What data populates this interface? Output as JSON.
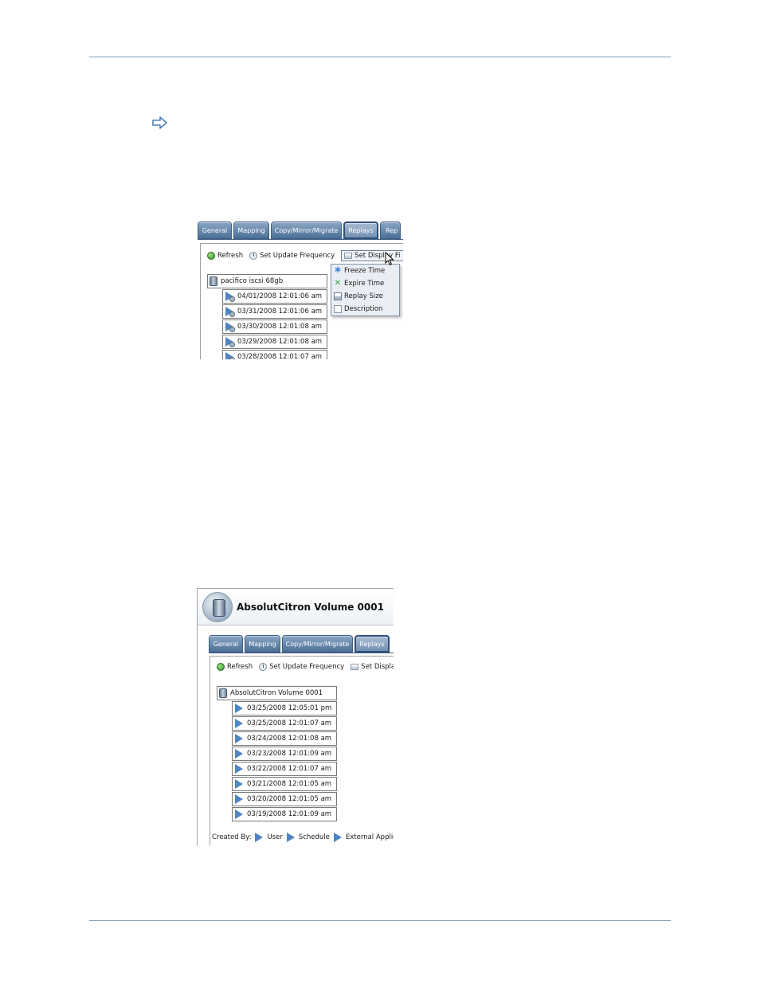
{
  "screenshot1": {
    "tabs": [
      "General",
      "Mapping",
      "Copy/Mirror/Migrate",
      "Replays",
      "Rep"
    ],
    "active_tab": "Replays",
    "toolbar": {
      "refresh": "Refresh",
      "update_frequency": "Set Update Frequency",
      "display_fields": "Set Display Fi"
    },
    "tree": {
      "root": "pacifico iscsi 68gb",
      "replays": [
        "04/01/2008 12:01:06 am",
        "03/31/2008 12:01:06 am",
        "03/30/2008 12:01:08 am",
        "03/29/2008 12:01:08 am",
        "03/28/2008 12:01:07 am"
      ]
    },
    "menu": {
      "items": [
        "Freeze Time",
        "Expire Time",
        "Replay Size",
        "Description"
      ]
    }
  },
  "screenshot2": {
    "title": "AbsolutCitron Volume 0001",
    "tabs": [
      "General",
      "Mapping",
      "Copy/Mirror/Migrate",
      "Replays"
    ],
    "active_tab": "Replays",
    "toolbar": {
      "refresh": "Refresh",
      "update_frequency": "Set Update Frequency",
      "display_fields": "Set Display F"
    },
    "tree": {
      "root": "AbsolutCitron Volume 0001",
      "replays": [
        "03/25/2008 12:05:01 pm",
        "03/25/2008 12:01:07 am",
        "03/24/2008 12:01:08 am",
        "03/23/2008 12:01:09 am",
        "03/22/2008 12:01:07 am",
        "03/21/2008 12:01:05 am",
        "03/20/2008 12:01:05 am",
        "03/19/2008 12:01:09 am"
      ]
    },
    "legend": {
      "label": "Created By:",
      "items": [
        "User",
        "Schedule",
        "External Application"
      ]
    }
  },
  "colors": {
    "rule": "#7f9fb6",
    "tab": "#4b6f97",
    "replay_icon": "#4f86c2"
  },
  "icons": {
    "note_marker": "right-arrow-outline-icon"
  }
}
